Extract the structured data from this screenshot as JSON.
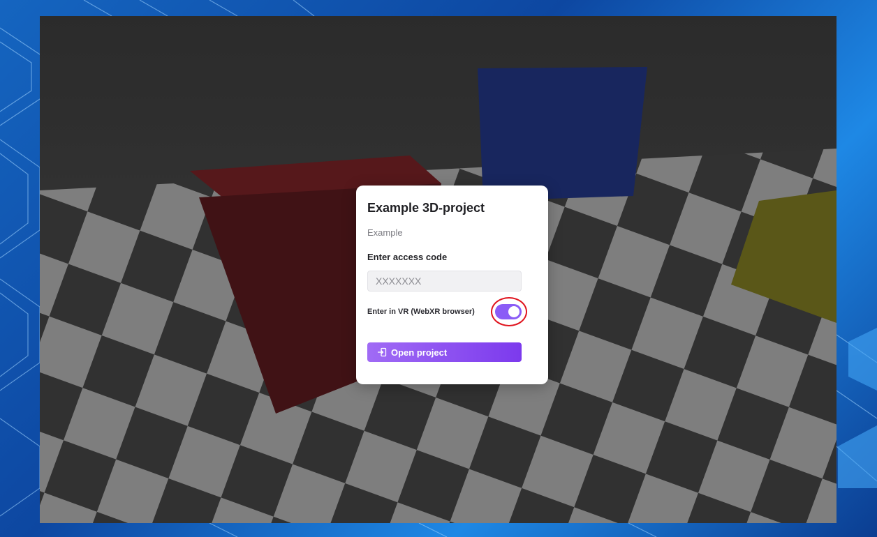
{
  "dialog": {
    "title": "Example 3D-project",
    "subtitle": "Example",
    "access_code_label": "Enter access code",
    "access_code_placeholder": "XXXXXXX",
    "access_code_value": "",
    "vr_label": "Enter in VR (WebXR browser)",
    "vr_toggle_on": true,
    "open_button_label": "Open project",
    "open_button_icon": "login-icon"
  },
  "colors": {
    "accent": "#8b5cf6",
    "button_gradient_start": "#a06bf5",
    "button_gradient_end": "#7c3aed",
    "highlight": "#e0141e",
    "cube_red": "#5a1a1e",
    "cube_blue": "#1e2f73",
    "cube_yellow": "#6e6b1e"
  }
}
